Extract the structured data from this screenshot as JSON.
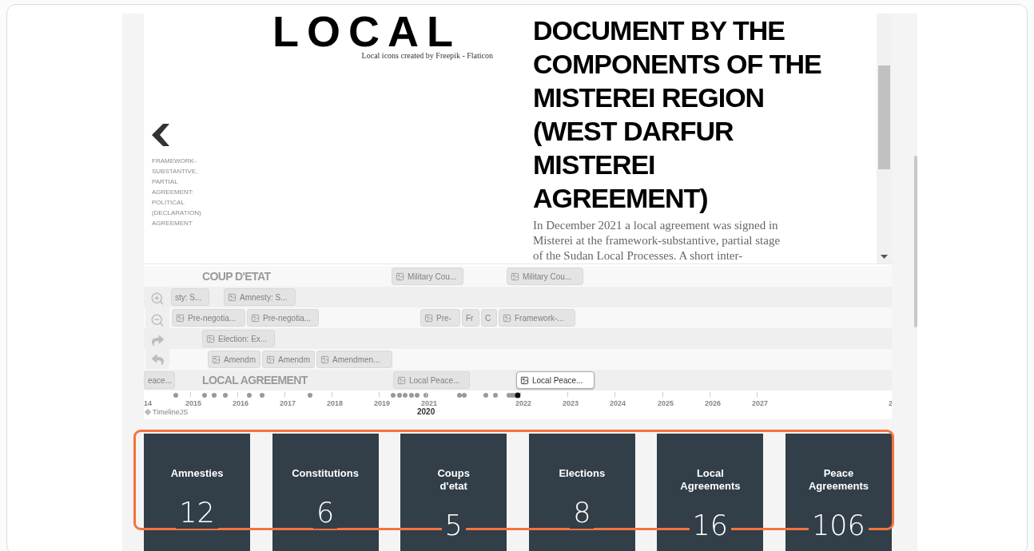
{
  "slide": {
    "logo_text": "LOCAL",
    "logo_credit": "Local icons created by Freepik - Flaticon",
    "previous": {
      "label": "FRAMEWORK-SUBSTANTIVE, PARTIAL AGREEMENT: POLITICAL (DECLARATION) AGREEMENT"
    },
    "headline": "DOCUMENT BY THE COMPONENTS OF THE MISTEREI REGION (WEST DARFUR MISTEREI AGREEMENT)",
    "body": "In December 2021 a local agreement was signed in Misterei at the framework-substantive, partial stage of the Sudan Local Processes. A short inter-"
  },
  "timeline": {
    "rows": [
      {
        "group": "COUP D'ETAT",
        "events": [
          {
            "label": "Military Cou...",
            "selected": false
          },
          {
            "label": "Military Cou...",
            "selected": false
          }
        ]
      },
      {
        "events": [
          {
            "label": "sty: S...",
            "selected": false
          },
          {
            "label": "Amnesty: S...",
            "selected": false
          }
        ]
      },
      {
        "events": [
          {
            "label": "Pre-negotia...",
            "selected": false
          },
          {
            "label": "Pre-negotia...",
            "selected": false
          },
          {
            "label": "Pre-",
            "selected": false
          },
          {
            "label": "Fr",
            "selected": false
          },
          {
            "label": "C",
            "selected": false
          },
          {
            "label": "Framework-...",
            "selected": false
          }
        ]
      },
      {
        "events": [
          {
            "label": "Election: Ex...",
            "selected": false
          }
        ]
      },
      {
        "events": [
          {
            "label": "Amendm",
            "selected": false
          },
          {
            "label": "Amendm",
            "selected": false
          },
          {
            "label": "Amendmen...",
            "selected": false
          }
        ]
      },
      {
        "group": "LOCAL AGREEMENT",
        "events": [
          {
            "label": "eace...",
            "selected": false
          },
          {
            "label": "Local Peace...",
            "selected": false
          },
          {
            "label": "Local Peace...",
            "selected": true
          }
        ]
      }
    ],
    "minor_ticks": [
      "14",
      "2015",
      "2016",
      "2017",
      "2018",
      "2019",
      "2021",
      "2022",
      "2023",
      "2024",
      "2025",
      "2026",
      "2027",
      "2"
    ],
    "major_ticks": [
      "2020"
    ],
    "credit": "TimelineJS"
  },
  "stats": [
    {
      "label": "Amnesties",
      "count": "12"
    },
    {
      "label": "Constitutions",
      "count": "6"
    },
    {
      "label": "Coups\nd'etat",
      "count": "5"
    },
    {
      "label": "Elections",
      "count": "8"
    },
    {
      "label": "Local\nAgreements",
      "count": "16"
    },
    {
      "label": "Peace\nAgreements",
      "count": "106"
    }
  ]
}
